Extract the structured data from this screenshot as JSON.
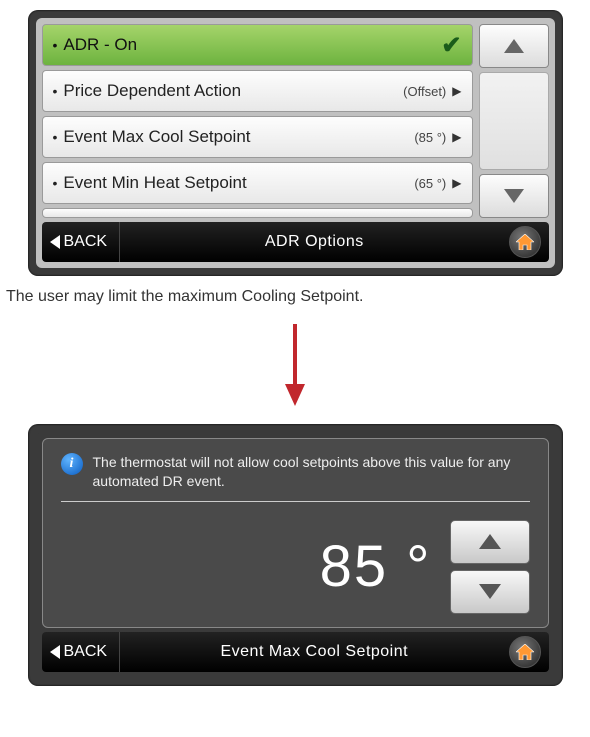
{
  "screen1": {
    "rows": [
      {
        "label": "ADR - On",
        "value": "",
        "selected": true
      },
      {
        "label": "Price Dependent Action",
        "value": "(Offset)",
        "selected": false
      },
      {
        "label": "Event Max Cool Setpoint",
        "value": "(85 °)",
        "selected": false
      },
      {
        "label": "Event Min Heat Setpoint",
        "value": "(65 °)",
        "selected": false
      }
    ],
    "back": "BACK",
    "title": "ADR Options"
  },
  "caption": "The user may limit the maximum Cooling Setpoint.",
  "screen2": {
    "info": "The thermostat will not allow cool setpoints above this value for any automated DR event.",
    "value": "85 °",
    "back": "BACK",
    "title": "Event Max Cool Setpoint"
  }
}
